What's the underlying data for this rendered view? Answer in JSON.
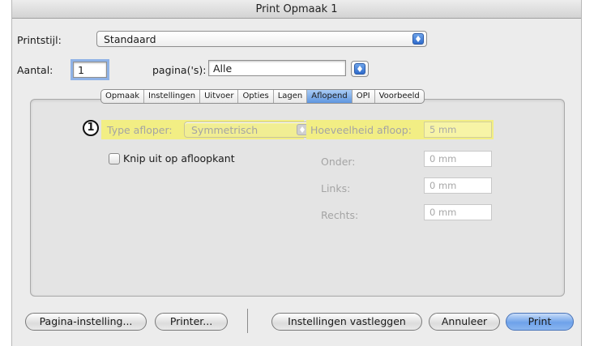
{
  "window": {
    "title": "Print Opmaak 1"
  },
  "printstijl": {
    "label": "Printstijl:",
    "value": "Standaard"
  },
  "aantal": {
    "label": "Aantal:",
    "value": "1"
  },
  "paginas": {
    "label": "pagina('s):",
    "value": "Alle"
  },
  "tabs": [
    {
      "label": "Opmaak"
    },
    {
      "label": "Instellingen"
    },
    {
      "label": "Uitvoer"
    },
    {
      "label": "Opties"
    },
    {
      "label": "Lagen"
    },
    {
      "label": "Aflopend"
    },
    {
      "label": "OPI"
    },
    {
      "label": "Voorbeeld"
    }
  ],
  "active_tab": "Aflopend",
  "bleed": {
    "callout": "1",
    "type_label": "Type afloper:",
    "type_value": "Symmetrisch",
    "amount_label": "Hoeveelheid afloop:",
    "amount_value": "5 mm",
    "clip_label": "Knip uit op afloopkant",
    "bottom_label": "Onder:",
    "bottom_value": "0 mm",
    "left_label": "Links:",
    "left_value": "0 mm",
    "right_label": "Rechts:",
    "right_value": "0 mm"
  },
  "buttons": {
    "page_setup": "Pagina-instelling...",
    "printer": "Printer...",
    "save_settings": "Instellingen vastleggen",
    "cancel": "Annuleer",
    "print": "Print"
  },
  "colors": {
    "highlight": "#f2ee84",
    "accent": "#6ea2ea"
  }
}
